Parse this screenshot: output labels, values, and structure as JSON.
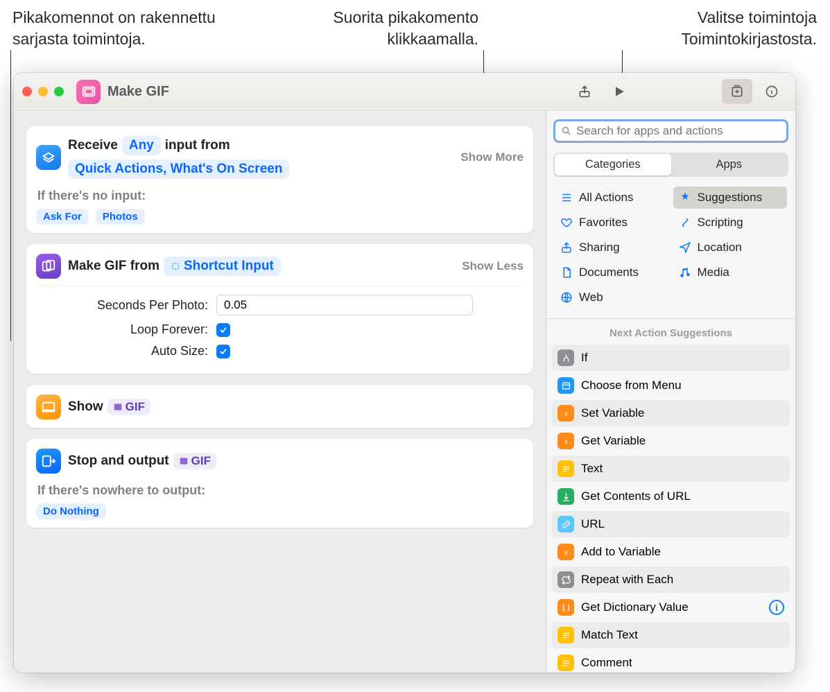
{
  "callouts": {
    "left": "Pikakomennot on rakennettu sarjasta toimintoja.",
    "mid": "Suorita pikakomento klikkaamalla.",
    "right": "Valitse toimintoja Toimintokirjastosta."
  },
  "titlebar": {
    "title": "Make GIF"
  },
  "actions": {
    "receive": {
      "text1": "Receive",
      "token_any": "Any",
      "text2": "input from",
      "token_src": "Quick Actions, What's On Screen",
      "show_more": "Show More",
      "noinput_label": "If there's no input:",
      "askfor": "Ask For",
      "photos": "Photos"
    },
    "makegif": {
      "text1": "Make GIF from",
      "token": "Shortcut Input",
      "show_less": "Show Less",
      "sec_label": "Seconds Per Photo:",
      "sec_value": "0.05",
      "loop_label": "Loop Forever:",
      "auto_label": "Auto Size:"
    },
    "show": {
      "text": "Show",
      "pill": "GIF"
    },
    "stop": {
      "text": "Stop and output",
      "pill": "GIF",
      "nowhere": "If there's nowhere to output:",
      "donothing": "Do Nothing"
    }
  },
  "sidebar": {
    "search_placeholder": "Search for apps and actions",
    "seg": {
      "a": "Categories",
      "b": "Apps"
    },
    "cats": {
      "all": "All Actions",
      "suggestions": "Suggestions",
      "favorites": "Favorites",
      "scripting": "Scripting",
      "sharing": "Sharing",
      "location": "Location",
      "documents": "Documents",
      "media": "Media",
      "web": "Web"
    },
    "sugg_header": "Next Action Suggestions",
    "sugg": {
      "if": "If",
      "menu": "Choose from Menu",
      "setvar": "Set Variable",
      "getvar": "Get Variable",
      "text": "Text",
      "geturl": "Get Contents of URL",
      "url": "URL",
      "addvar": "Add to Variable",
      "repeat": "Repeat with Each",
      "dict": "Get Dictionary Value",
      "match": "Match Text",
      "comment": "Comment"
    }
  }
}
